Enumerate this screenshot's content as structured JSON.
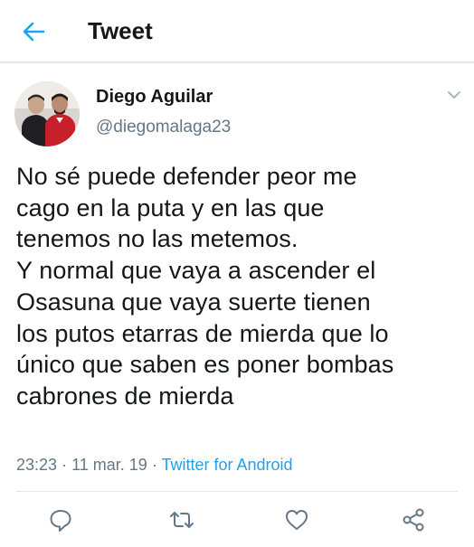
{
  "header": {
    "title": "Tweet",
    "back_icon": "back-arrow-icon"
  },
  "tweet": {
    "display_name": "Diego Aguilar",
    "handle": "@diegomalaga23",
    "text": "No sé puede defender peor me\ncago en la puta y en las que\ntenemos no las metemos.\nY normal que vaya a ascender el\nOsasuna que vaya suerte tienen\nlos putos etarras de mierda que lo\núnico que saben es poner bombas\ncabrones de mierda",
    "time": "23:23",
    "date": "11 mar. 19",
    "separator": "·",
    "source": "Twitter for Android"
  },
  "actions": {
    "reply_icon": "reply-icon",
    "retweet_icon": "retweet-icon",
    "like_icon": "heart-icon",
    "share_icon": "share-icon"
  },
  "colors": {
    "accent": "#1da1f2",
    "text_primary": "#14171a",
    "text_secondary": "#657786",
    "divider": "#e1e8ed"
  }
}
